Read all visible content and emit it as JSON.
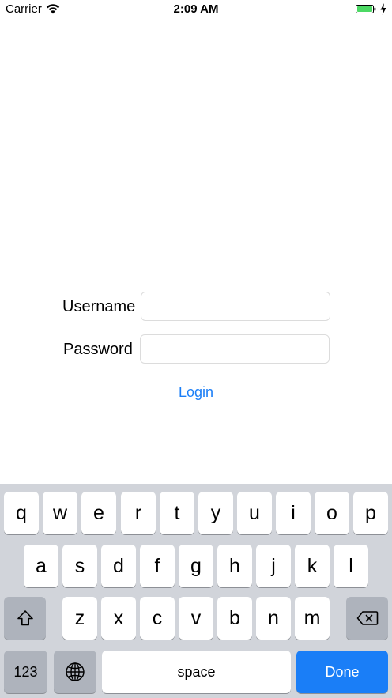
{
  "status_bar": {
    "carrier": "Carrier",
    "time": "2:09 AM",
    "wifi_icon": "wifi-icon",
    "battery_icon": "battery-charging-icon",
    "battery_color": "#4cd964"
  },
  "login_form": {
    "username_label": "Username",
    "username_value": "",
    "password_label": "Password",
    "password_value": "",
    "login_label": "Login",
    "accent_color": "#1a7ef7"
  },
  "keyboard": {
    "row1": [
      "q",
      "w",
      "e",
      "r",
      "t",
      "y",
      "u",
      "i",
      "o",
      "p"
    ],
    "row2": [
      "a",
      "s",
      "d",
      "f",
      "g",
      "h",
      "j",
      "k",
      "l"
    ],
    "row3": [
      "z",
      "x",
      "c",
      "v",
      "b",
      "n",
      "m"
    ],
    "shift_icon": "shift-icon",
    "delete_icon": "backspace-icon",
    "globe_icon": "globe-icon",
    "numbers_label": "123",
    "space_label": "space",
    "done_label": "Done"
  }
}
